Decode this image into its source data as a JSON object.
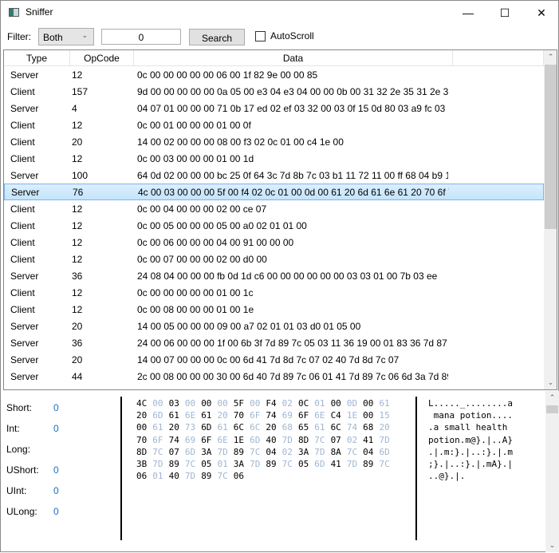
{
  "window": {
    "title": "Sniffer",
    "minimize": "—",
    "maximize": "☐",
    "close": "✕"
  },
  "toolbar": {
    "filter_label": "Filter:",
    "filter_value": "Both",
    "search_value": "0",
    "search_button": "Search",
    "autoscroll_label": "AutoScroll",
    "autoscroll_checked": false
  },
  "list": {
    "columns": [
      "Type",
      "OpCode",
      "Data"
    ],
    "selected_index": 7,
    "rows": [
      {
        "type": "Server",
        "opcode": "12",
        "data": "0c 00 00 00 00 00 06 00 1f 82 9e 00 00 85"
      },
      {
        "type": "Client",
        "opcode": "157",
        "data": "9d 00 00 00 00 00 0a 05 00 e3 04 e3 04 00 00 0b 00 31 32 2e 35 31 2e 31"
      },
      {
        "type": "Server",
        "opcode": "4",
        "data": "04 07 01 00 00 00 71 0b 17 ed 02 ef 03 32 00 03 0f 15 0d 80 03 a9 fc 03 8"
      },
      {
        "type": "Client",
        "opcode": "12",
        "data": "0c 00 01 00 00 00 01 00 0f"
      },
      {
        "type": "Client",
        "opcode": "20",
        "data": "14 00 02 00 00 00 08 00 f3 02 0c 01 00 c4 1e 00"
      },
      {
        "type": "Client",
        "opcode": "12",
        "data": "0c 00 03 00 00 00 01 00 1d"
      },
      {
        "type": "Server",
        "opcode": "100",
        "data": "64 0d 02 00 00 00 bc 25 0f 64 3c 7d 8b 7c 03 b1 11 72 11 00 ff 68 04 b9 1"
      },
      {
        "type": "Server",
        "opcode": "76",
        "data": "4c 00 03 00 00 00 5f 00 f4 02 0c 01 00 0d 00 61 20 6d 61 6e 61 20 70 6f 74"
      },
      {
        "type": "Client",
        "opcode": "12",
        "data": "0c 00 04 00 00 00 02 00 ce 07"
      },
      {
        "type": "Client",
        "opcode": "12",
        "data": "0c 00 05 00 00 00 05 00 a0 02 01 01 00"
      },
      {
        "type": "Client",
        "opcode": "12",
        "data": "0c 00 06 00 00 00 04 00 91 00 00 00"
      },
      {
        "type": "Client",
        "opcode": "12",
        "data": "0c 00 07 00 00 00 02 00 d0 00"
      },
      {
        "type": "Server",
        "opcode": "36",
        "data": "24 08 04 00 00 00 fb 0d 1d c6 00 00 00 00 00 00 03 03 01 00 7b 03 ee"
      },
      {
        "type": "Client",
        "opcode": "12",
        "data": "0c 00 00 00 00 00 01 00 1c"
      },
      {
        "type": "Client",
        "opcode": "12",
        "data": "0c 00 08 00 00 00 01 00 1e"
      },
      {
        "type": "Server",
        "opcode": "20",
        "data": "14 00 05 00 00 00 09 00 a7 02 01 01 03 d0 01 05 00"
      },
      {
        "type": "Server",
        "opcode": "36",
        "data": "24 00 06 00 00 00 1f 00 6b 3f 7d 89 7c 05 03 11 36 19 00 01 83 36 7d 87 7"
      },
      {
        "type": "Server",
        "opcode": "20",
        "data": "14 00 07 00 00 00 0c 00 6d 41 7d 8d 7c 07 02 40 7d 8d 7c 07"
      },
      {
        "type": "Server",
        "opcode": "44",
        "data": "2c 00 08 00 00 00 30 00 6d 40 7d 89 7c 06 01 41 7d 89 7c 06 6d 3a 7d 89"
      }
    ]
  },
  "values": [
    {
      "label": "Short:",
      "value": "0"
    },
    {
      "label": "Int:",
      "value": "0"
    },
    {
      "label": "Long:",
      "value": ""
    },
    {
      "label": "UShort:",
      "value": "0"
    },
    {
      "label": "UInt:",
      "value": "0"
    },
    {
      "label": "ULong:",
      "value": "0"
    }
  ],
  "hex_rows": [
    "4C 00 03 00 00 00 5F 00 F4 02 0C 01 00 0D 00 61",
    "20 6D 61 6E 61 20 70 6F 74 69 6F 6E C4 1E 00 15",
    "00 61 20 73 6D 61 6C 6C 20 68 65 61 6C 74 68 20",
    "70 6F 74 69 6F 6E 1E 6D 40 7D 8D 7C 07 02 41 7D",
    "8D 7C 07 6D 3A 7D 89 7C 04 02 3A 7D 8A 7C 04 6D",
    "3B 7D 89 7C 05 01 3A 7D 89 7C 05 6D 41 7D 89 7C",
    "06 01 40 7D 89 7C 06"
  ],
  "ascii_rows": [
    "L....._........a",
    " mana potion....",
    ".a small health ",
    "potion.m@}.|..A}",
    ".|.m:}.|..:}.|.m",
    ";}.|..:}.|.mA}.|",
    "..@}.|."
  ],
  "colors": {
    "selection": "#c4e4fb",
    "hex_alt": "#9fb6d4",
    "value": "#1a6fc0"
  }
}
